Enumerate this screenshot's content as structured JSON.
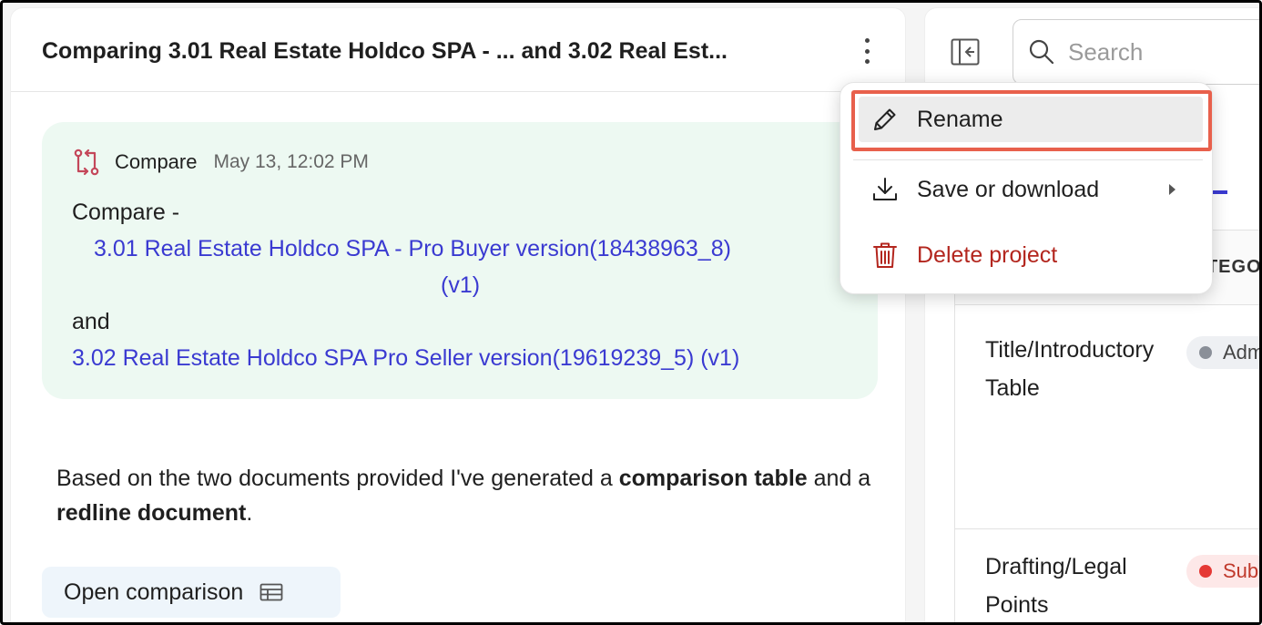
{
  "header": {
    "title": "Comparing 3.01 Real Estate Holdco SPA - ... and 3.02 Real Est..."
  },
  "card": {
    "type_label": "Compare",
    "date": "May 13, 12:02 PM",
    "intro": "Compare -",
    "doc1_line1": "3.01 Real Estate Holdco SPA - Pro Buyer version(18438963_8)",
    "doc1_line2": "(v1)",
    "connector": "and",
    "doc2": "3.02 Real Estate Holdco SPA Pro Seller version(19619239_5) (v1)"
  },
  "summary": {
    "p1": "Based on the two documents provided I've generated a ",
    "b1": "comparison table",
    "p2": " and a ",
    "b2": "redline document",
    "p3": "."
  },
  "open_button": {
    "label": "Open comparison"
  },
  "search": {
    "placeholder": "Search"
  },
  "table": {
    "category_header": "ATEGO",
    "rows": [
      {
        "title": "Title/Introductory Table",
        "tag": "Adm",
        "tag_color": "#8a8f98"
      },
      {
        "title": "Drafting/Legal Points",
        "tag": "Sub",
        "tag_color": "#e53935"
      }
    ]
  },
  "menu": {
    "items": [
      {
        "label": "Rename",
        "icon": "pencil-icon"
      },
      {
        "label": "Save or download",
        "icon": "download-icon"
      },
      {
        "label": "Delete project",
        "icon": "trash-icon"
      }
    ],
    "delete_color": "#b3261e",
    "highlight_color": "#e8604c"
  },
  "colors": {
    "link": "#3a3ad1",
    "card_bg": "#edf9f2"
  }
}
